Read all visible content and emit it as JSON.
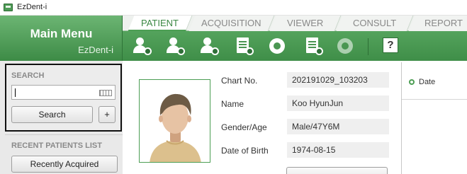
{
  "window": {
    "title": "EzDent-i"
  },
  "menu": {
    "title": "Main Menu",
    "subtitle": "EzDent-i"
  },
  "tabs": [
    {
      "label": "PATIENT",
      "active": true
    },
    {
      "label": "ACQUISITION",
      "active": false
    },
    {
      "label": "VIEWER",
      "active": false
    },
    {
      "label": "CONSULT",
      "active": false
    },
    {
      "label": "REPORT",
      "active": false
    }
  ],
  "toolbar": {
    "icons": [
      "add-patient-icon",
      "edit-patient-icon",
      "delete-patient-icon",
      "patient-chart-icon",
      "share-icon",
      "search-record-icon",
      "export-icon",
      "help-icon"
    ],
    "help_label": "?"
  },
  "search": {
    "section_label": "SEARCH",
    "input_value": "",
    "button_label": "Search",
    "plus_label": "+"
  },
  "recent": {
    "section_label": "RECENT PATIENTS LIST",
    "button_label": "Recently Acquired"
  },
  "patient": {
    "fields": [
      {
        "label": "Chart No.",
        "value": "202191029_103203"
      },
      {
        "label": "Name",
        "value": "Koo HyunJun"
      },
      {
        "label": "Gender/Age",
        "value": "Male/47Y6M"
      },
      {
        "label": "Date of Birth",
        "value": "1974-08-15"
      }
    ]
  },
  "right_panel": {
    "date_label": "Date"
  },
  "colors": {
    "brand_green": "#4c9e54",
    "header_green": "#3f8e48"
  }
}
